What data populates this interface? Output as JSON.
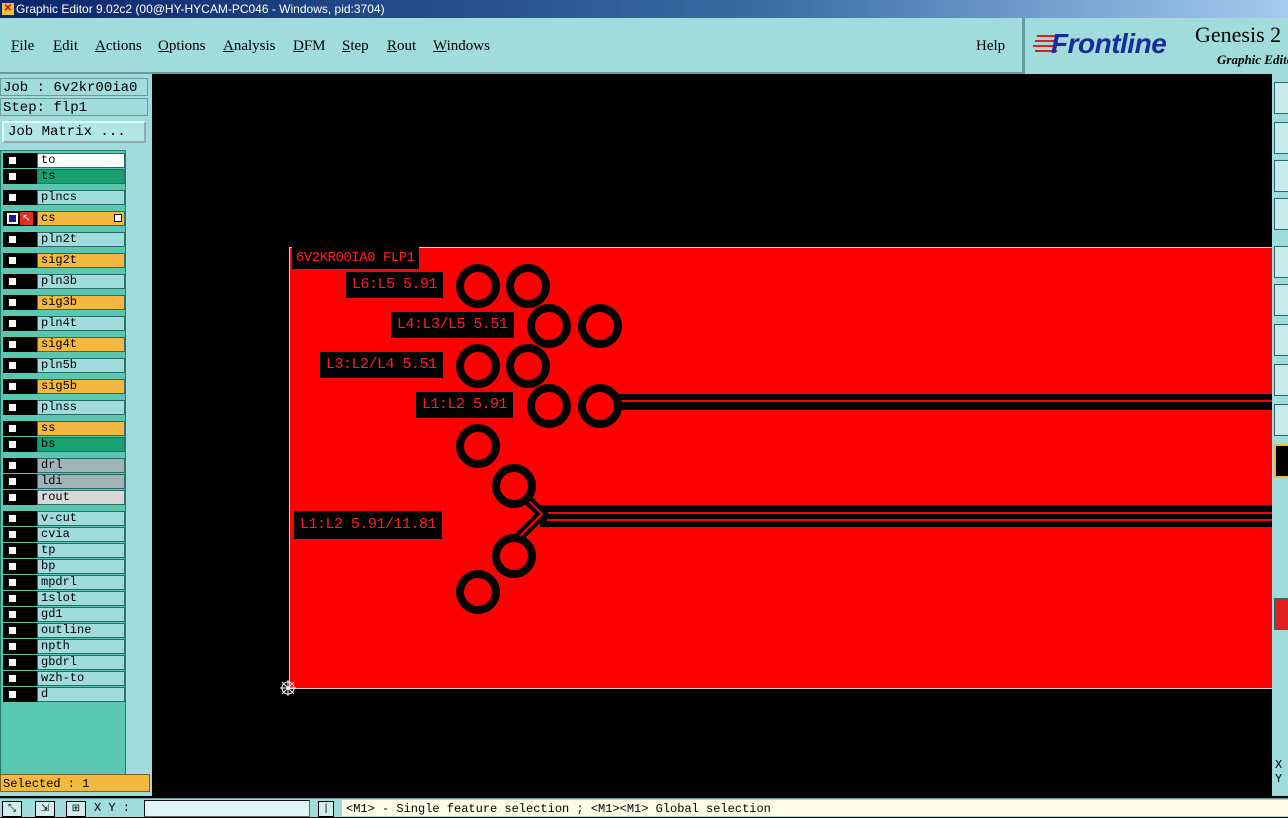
{
  "window": {
    "title": "Graphic Editor 9.02c2 (00@HY-HYCAM-PC046 - Windows, pid:3704)",
    "icon": "app-icon"
  },
  "menu": [
    {
      "first": "F",
      "rest": "ile"
    },
    {
      "first": "E",
      "rest": "dit"
    },
    {
      "first": "A",
      "rest": "ctions"
    },
    {
      "first": "O",
      "rest": "ptions"
    },
    {
      "first": "A",
      "rest": "nalysis"
    },
    {
      "first": "D",
      "rest": "FM"
    },
    {
      "first": "S",
      "rest": "tep"
    },
    {
      "first": "R",
      "rest": "out"
    },
    {
      "first": "W",
      "rest": "indows"
    }
  ],
  "help_label": "Help",
  "brand": {
    "logo": "Frontline",
    "product": "Genesis 2",
    "subtitle": "Graphic Editor"
  },
  "job": {
    "job_line": "Job : 6v2kr00ia0",
    "step_line": "Step: flp1",
    "matrix_button": "Job Matrix ..."
  },
  "layers": [
    {
      "name": "to",
      "color": "#ffffff"
    },
    {
      "name": "ts",
      "color": "#1aa070"
    },
    {
      "name": "plncs",
      "color": "#a0dcdc"
    },
    {
      "name": "cs",
      "color": "#f4b840",
      "active": true
    },
    {
      "name": "pln2t",
      "color": "#a0dcdc"
    },
    {
      "name": "sig2t",
      "color": "#f4b840"
    },
    {
      "name": "pln3b",
      "color": "#a0dcdc"
    },
    {
      "name": "sig3b",
      "color": "#f4b840"
    },
    {
      "name": "pln4t",
      "color": "#a0dcdc"
    },
    {
      "name": "sig4t",
      "color": "#f4b840"
    },
    {
      "name": "pln5b",
      "color": "#a0dcdc"
    },
    {
      "name": "sig5b",
      "color": "#f4b840"
    },
    {
      "name": "plnss",
      "color": "#a0dcdc"
    },
    {
      "name": "ss",
      "color": "#f4b840"
    },
    {
      "name": "bs",
      "color": "#1aa070"
    },
    {
      "name": "drl",
      "color": "#a0b4b8"
    },
    {
      "name": "ldi",
      "color": "#a0b4b8"
    },
    {
      "name": "rout",
      "color": "#d8d8d8"
    },
    {
      "name": "v-cut",
      "color": "#a0dcdc"
    },
    {
      "name": "cvia",
      "color": "#a0dcdc"
    },
    {
      "name": "tp",
      "color": "#a0dcdc"
    },
    {
      "name": "bp",
      "color": "#a0dcdc"
    },
    {
      "name": "mpdrl",
      "color": "#a0dcdc"
    },
    {
      "name": "1slot",
      "color": "#a0dcdc"
    },
    {
      "name": "gd1",
      "color": "#a0dcdc"
    },
    {
      "name": "outline",
      "color": "#a0dcdc"
    },
    {
      "name": "npth",
      "color": "#a0dcdc"
    },
    {
      "name": "gbdrl",
      "color": "#a0dcdc"
    },
    {
      "name": "wzh-to",
      "color": "#a0dcdc"
    },
    {
      "name": "d",
      "color": "#a0dcdc"
    }
  ],
  "selected_text": "Selected : 1",
  "status": {
    "xy_label": "X Y :",
    "xy_value": "",
    "message": "<M1> - Single feature selection ; <M1><M1> Global selection"
  },
  "right_xy": {
    "x": "X",
    "y": "Y"
  },
  "board": {
    "header": "6V2KR00IA0 FLP1",
    "labels": [
      "L6:L5 5.91",
      "L4:L3/L5 5.51",
      "L3:L2/L4 5.51",
      "L1:L2 5.91",
      "L1:L2 5.91/11.81"
    ]
  },
  "colors": {
    "panel": "#a0dcdc",
    "copper": "#ff0000",
    "accent_orange": "#f4b840"
  }
}
